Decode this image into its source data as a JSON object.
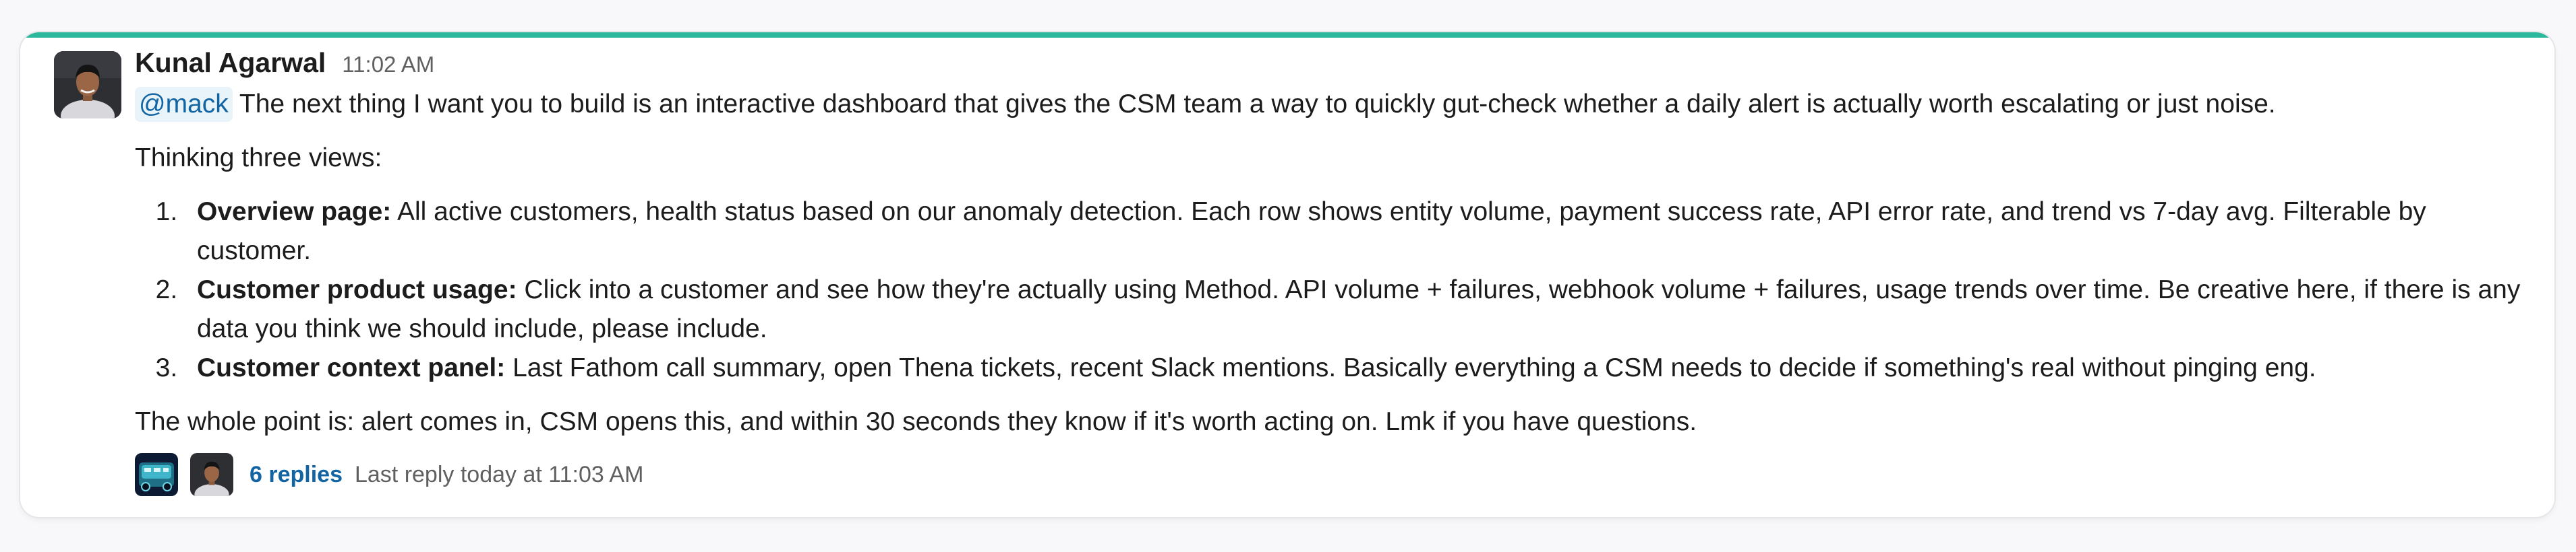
{
  "message": {
    "author": "Kunal Agarwal",
    "timestamp": "11:02 AM",
    "mention": "@mack",
    "intro": " The next thing I want you to build is an interactive dashboard that gives the CSM team a way to quickly gut-check whether a daily alert is actually worth escalating or just noise.",
    "subheading": "Thinking three views:",
    "views": [
      {
        "title": "Overview page:",
        "text": " All active customers, health status based on our anomaly detection. Each row shows entity volume, payment success rate, API error rate, and trend vs 7-day avg. Filterable by customer."
      },
      {
        "title": "Customer product usage:",
        "text": " Click into a customer and see how they're actually using Method. API volume + failures, webhook volume + failures, usage trends over time. Be creative here, if there is any data you think we should include, please include."
      },
      {
        "title": "Customer context panel:",
        "text": " Last Fathom call summary, open Thena tickets, recent Slack mentions. Basically everything a CSM needs to decide if something's real without pinging eng."
      }
    ],
    "closing": "The whole point is: alert comes in, CSM opens this, and within 30 seconds they know if it's worth acting on. Lmk if you have questions."
  },
  "thread": {
    "reply_count": "6 replies",
    "last_reply": "Last reply today at 11:03 AM",
    "participants": [
      "bot-avatar-icon",
      "user-avatar"
    ]
  },
  "colors": {
    "accent_bar": "#2bb89c",
    "link": "#1264a3",
    "mention_bg": "#e8f3fa"
  }
}
